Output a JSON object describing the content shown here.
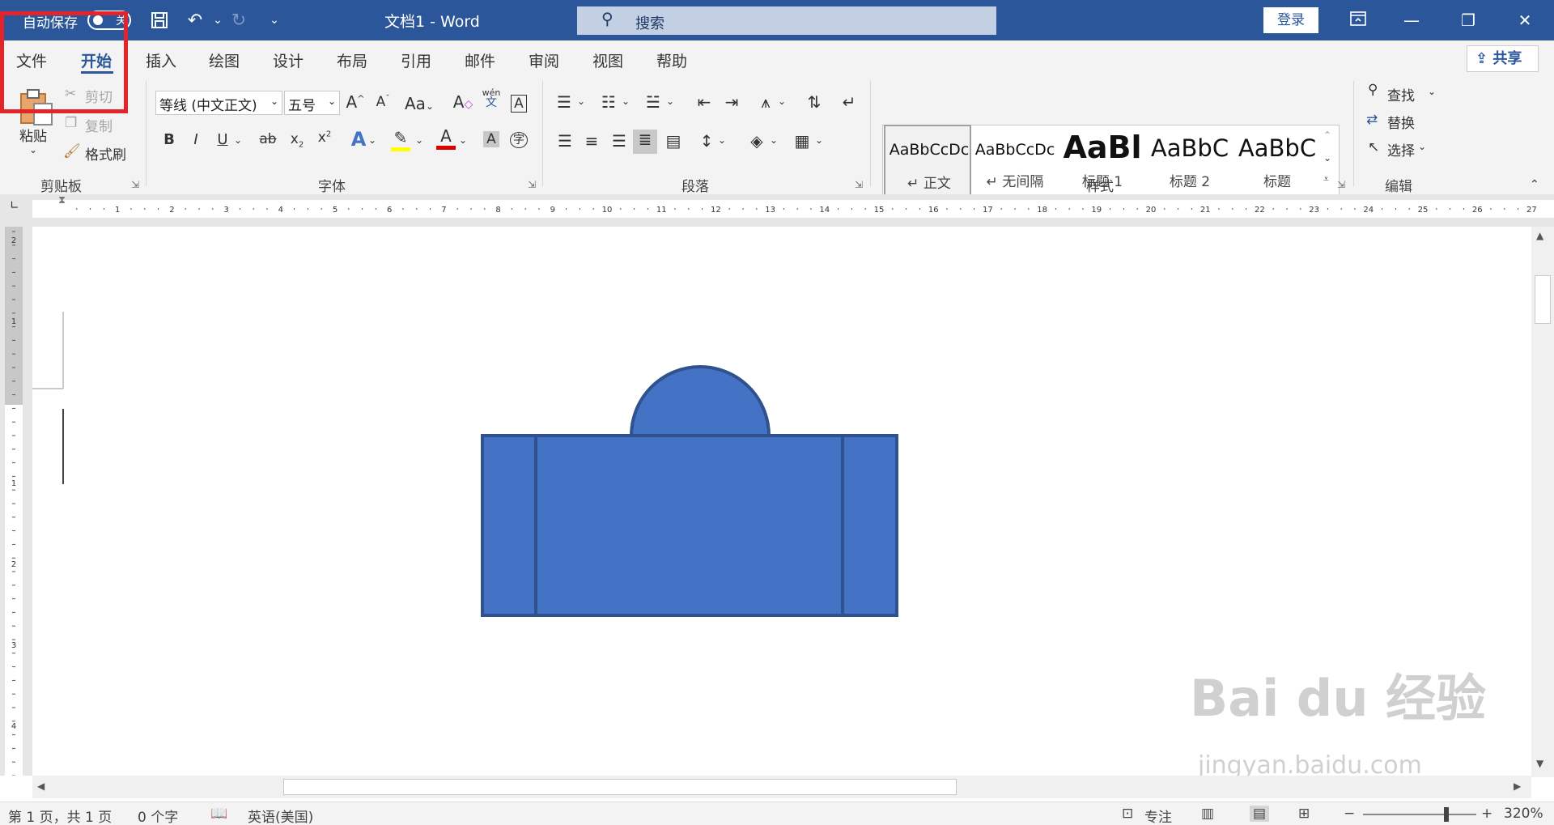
{
  "titlebar": {
    "autosave_label": "自动保存",
    "autosave_toggle": "关",
    "doc_title": "文档1  -  Word",
    "search_placeholder": "搜索",
    "login_label": "登录"
  },
  "tabs": [
    "文件",
    "开始",
    "插入",
    "绘图",
    "设计",
    "布局",
    "引用",
    "邮件",
    "审阅",
    "视图",
    "帮助"
  ],
  "active_tab": "开始",
  "share_label": "共享",
  "clipboard": {
    "paste": "粘贴",
    "cut": "剪切",
    "copy": "复制",
    "format_painter": "格式刷",
    "group_label": "剪贴板"
  },
  "font": {
    "font_name": "等线 (中文正文)",
    "font_size": "五号",
    "group_label": "字体",
    "phonetic_top": "wén",
    "phonetic_bottom": "文",
    "change_case": "Aa",
    "enclose_char": "字"
  },
  "paragraph": {
    "group_label": "段落"
  },
  "styles": {
    "group_label": "样式",
    "items": [
      {
        "preview": "AaBbCcDc",
        "name": "↵ 正文"
      },
      {
        "preview": "AaBbCcDc",
        "name": "↵ 无间隔"
      },
      {
        "preview": "AaBl",
        "name": "标题 1"
      },
      {
        "preview": "AaBbC",
        "name": "标题 2"
      },
      {
        "preview": "AaBbC",
        "name": "标题"
      }
    ]
  },
  "editing": {
    "find": "查找",
    "replace": "替换",
    "select": "选择",
    "group_label": "编辑"
  },
  "statusbar": {
    "page_info": "第 1 页，共 1 页",
    "word_count": "0 个字",
    "language": "英语(美国)",
    "focus": "专注",
    "zoom": "320%"
  },
  "ruler_numbers": [
    "1",
    "2",
    "3",
    "4",
    "5",
    "6",
    "7",
    "8",
    "9",
    "10",
    "11",
    "12",
    "13",
    "14",
    "15",
    "16",
    "17",
    "18",
    "19",
    "20",
    "21",
    "22",
    "23",
    "24",
    "25",
    "26",
    "27"
  ],
  "vruler_numbers": [
    "2",
    "1",
    "1",
    "2",
    "3",
    "4"
  ],
  "shape_color": "#4472c4",
  "shape_border": "#2f528f",
  "watermark": "Bai du 经验",
  "watermark_url": "jingyan.baidu.com"
}
